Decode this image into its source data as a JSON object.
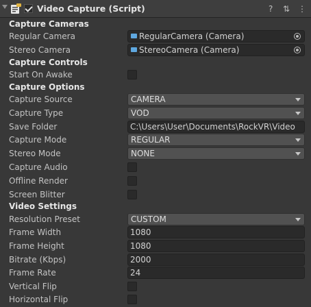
{
  "header": {
    "title": "Video Capture (Script)",
    "help_icon": "?",
    "settings_icon": "⇅",
    "menu_icon": "⋮"
  },
  "capture_cameras": {
    "heading": "Capture Cameras",
    "regular_label": "Regular Camera",
    "regular_value": "RegularCamera (Camera)",
    "stereo_label": "Stereo Camera",
    "stereo_value": "StereoCamera (Camera)"
  },
  "capture_controls": {
    "heading": "Capture Controls",
    "start_on_awake_label": "Start On Awake"
  },
  "capture_options": {
    "heading": "Capture Options",
    "source_label": "Capture Source",
    "source_value": "CAMERA",
    "type_label": "Capture Type",
    "type_value": "VOD",
    "folder_label": "Save Folder",
    "folder_value": "C:\\Users\\User\\Documents\\RockVR\\Video",
    "mode_label": "Capture Mode",
    "mode_value": "REGULAR",
    "stereo_mode_label": "Stereo Mode",
    "stereo_mode_value": "NONE",
    "audio_label": "Capture Audio",
    "offline_label": "Offline Render",
    "blitter_label": "Screen Blitter"
  },
  "video_settings": {
    "heading": "Video Settings",
    "preset_label": "Resolution Preset",
    "preset_value": "CUSTOM",
    "width_label": "Frame Width",
    "width_value": "1080",
    "height_label": "Frame Height",
    "height_value": "1080",
    "bitrate_label": "Bitrate (Kbps)",
    "bitrate_value": "2000",
    "framerate_label": "Frame Rate",
    "framerate_value": "24",
    "vflip_label": "Vertical Flip",
    "hflip_label": "Horizontal Flip"
  }
}
